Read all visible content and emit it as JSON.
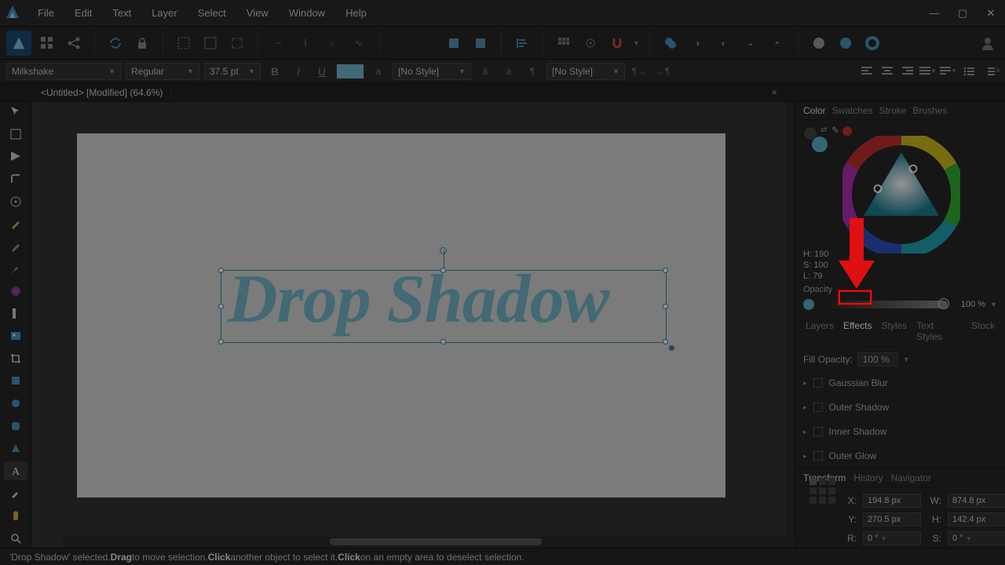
{
  "menu": {
    "file": "File",
    "edit": "Edit",
    "text": "Text",
    "layer": "Layer",
    "select": "Select",
    "view": "View",
    "window": "Window",
    "help": "Help"
  },
  "ctx": {
    "font": "Milkshake",
    "weight": "Regular",
    "size": "37.5 pt",
    "charstyle": "[No Style]",
    "parastyle": "[No Style]"
  },
  "doc": {
    "tab": "<Untitled> [Modified] (64.6%)"
  },
  "canvas": {
    "text": "Drop Shadow"
  },
  "panels": {
    "group1": {
      "color": "Color",
      "swatches": "Swatches",
      "stroke": "Stroke",
      "brushes": "Brushes"
    },
    "hsl": {
      "h": "H: 190",
      "s": "S: 100",
      "l": "L: 79"
    },
    "opacity": {
      "label": "Opacity",
      "value": "100 %"
    },
    "group2": {
      "layers": "Layers",
      "effects": "Effects",
      "styles": "Styles",
      "textstyles": "Text Styles",
      "stock": "Stock"
    },
    "fill": {
      "label": "Fill Opacity:",
      "value": "100 %"
    },
    "fx": {
      "gauss": "Gaussian Blur",
      "oshadow": "Outer Shadow",
      "ishadow": "Inner Shadow",
      "oglow": "Outer Glow"
    },
    "group3": {
      "transform": "Transform",
      "history": "History",
      "navigator": "Navigator"
    },
    "tf": {
      "x": "X:",
      "xv": "194.8 px",
      "w": "W:",
      "wv": "874.8 px",
      "y": "Y:",
      "yv": "270.5 px",
      "h": "H:",
      "hv": "142.4 px",
      "r": "R:",
      "rv": "0 °",
      "s": "S:",
      "sv": "0 °"
    }
  },
  "status": {
    "a": "'Drop Shadow' selected. ",
    "b1": "Drag",
    "c": " to move selection. ",
    "b2": "Click",
    "d": " another object to select it. ",
    "b3": "Click",
    "e": " on an empty area to deselect selection."
  }
}
